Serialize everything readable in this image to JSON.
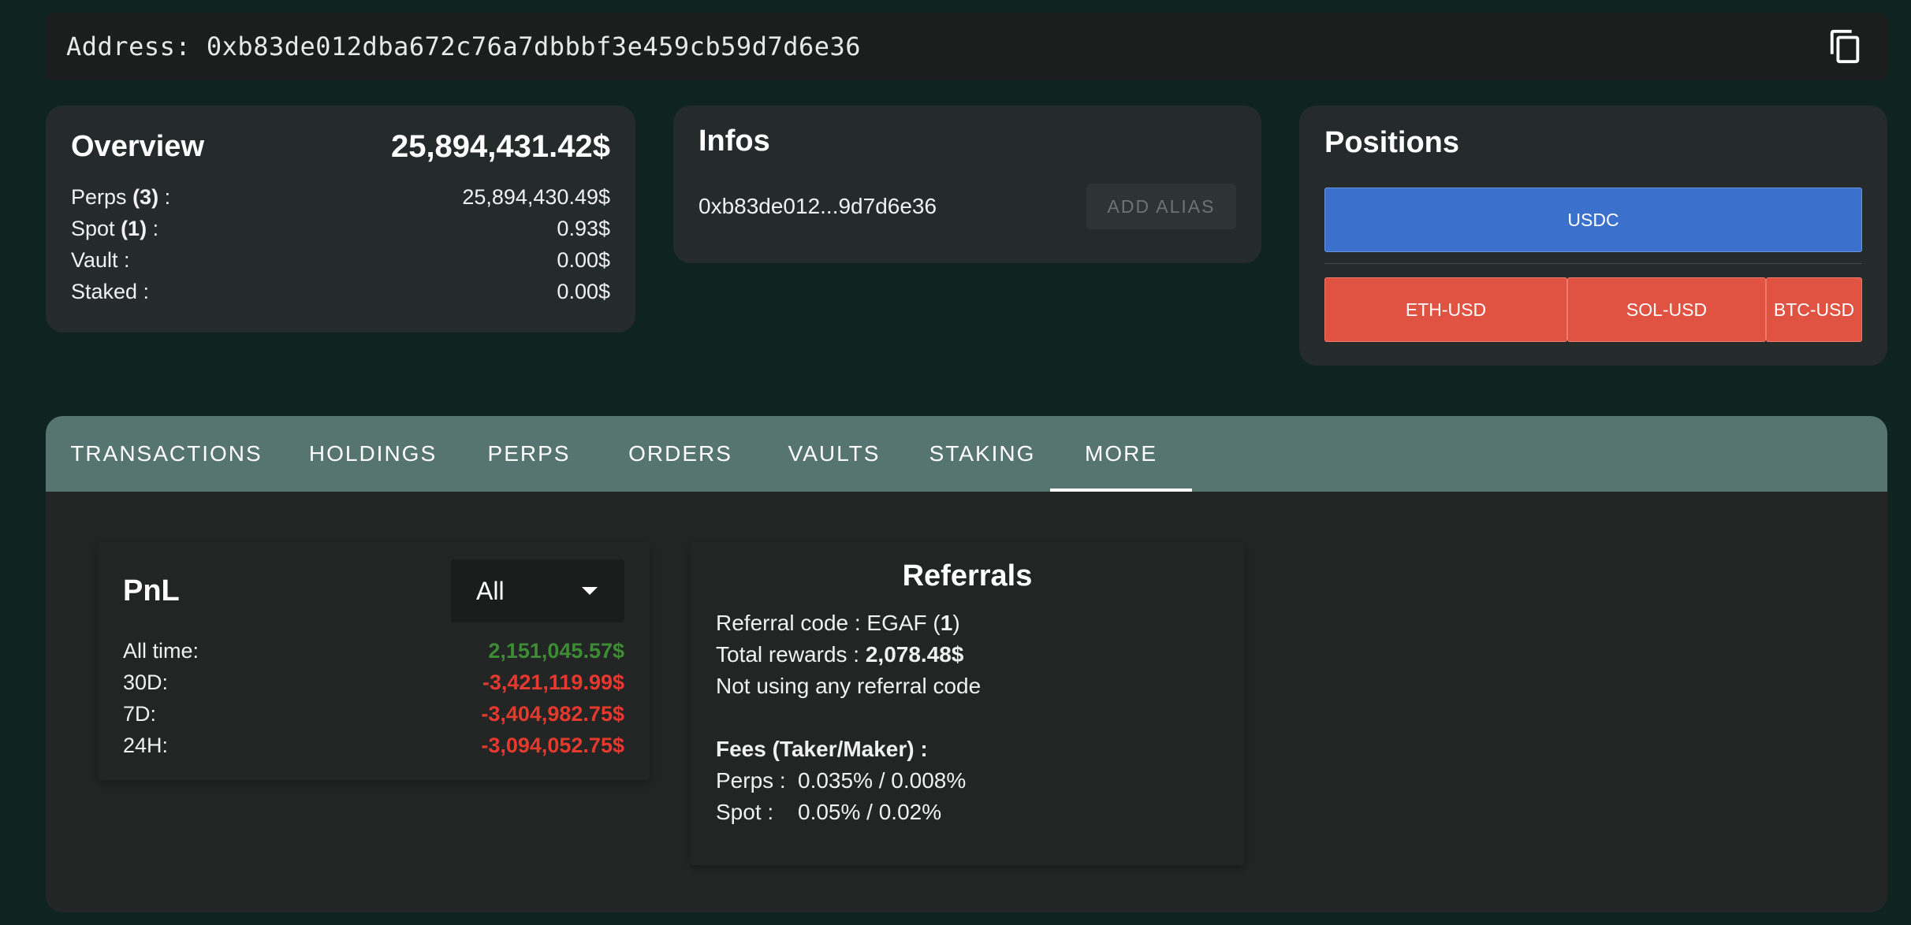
{
  "address_bar": {
    "prefix": "Address:",
    "address": "0xb83de012dba672c76a7dbbbf3e459cb59d7d6e36",
    "copy_icon": "copy-icon"
  },
  "overview": {
    "title": "Overview",
    "total": "25,894,431.42$",
    "rows": [
      {
        "label": "Perps",
        "count": "(3)",
        "suffix": " :",
        "value": "25,894,430.49$"
      },
      {
        "label": "Spot",
        "count": "(1)",
        "suffix": " :",
        "value": "0.93$"
      },
      {
        "label": "Vault :",
        "count": "",
        "suffix": "",
        "value": "0.00$"
      },
      {
        "label": "Staked :",
        "count": "",
        "suffix": "",
        "value": "0.00$"
      }
    ]
  },
  "infos": {
    "title": "Infos",
    "short_address": "0xb83de012...9d7d6e36",
    "add_alias_label": "ADD ALIAS"
  },
  "positions": {
    "title": "Positions",
    "primary": "USDC",
    "items": [
      "ETH-USD",
      "SOL-USD",
      "BTC-USD"
    ],
    "colors": {
      "primary": "#3b71cc",
      "items": "#e05242"
    }
  },
  "tabs": {
    "items": [
      "TRANSACTIONS",
      "HOLDINGS",
      "PERPS",
      "ORDERS",
      "VAULTS",
      "STAKING",
      "MORE"
    ],
    "active": "MORE"
  },
  "pnl": {
    "title": "PnL",
    "select_value": "All",
    "rows": [
      {
        "label": "All time:",
        "value": "2,151,045.57$",
        "sign": "positive"
      },
      {
        "label": "30D:",
        "value": "-3,421,119.99$",
        "sign": "negative"
      },
      {
        "label": "7D:",
        "value": "-3,404,982.75$",
        "sign": "negative"
      },
      {
        "label": "24H:",
        "value": "-3,094,052.75$",
        "sign": "negative"
      }
    ],
    "colors": {
      "positive": "#3d8c35",
      "negative": "#e5392e"
    }
  },
  "referrals": {
    "title": "Referrals",
    "code_label": "Referral code : EGAF (",
    "code_count": "1",
    "code_close": ")",
    "rewards_label": "Total rewards : ",
    "rewards_value": "2,078.48$",
    "not_using": "Not using any referral code",
    "fees_title": "Fees (Taker/Maker) :",
    "fees": [
      {
        "label": "Perps :",
        "value": "0.035% / 0.008%"
      },
      {
        "label": "Spot :",
        "value": "0.05% / 0.02%"
      }
    ]
  }
}
